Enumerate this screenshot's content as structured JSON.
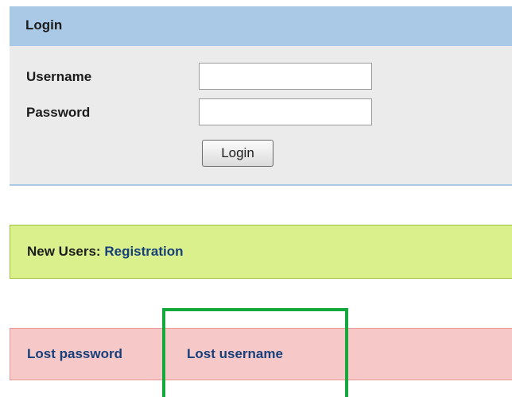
{
  "login": {
    "title": "Login",
    "username_label": "Username",
    "username_value": "",
    "password_label": "Password",
    "password_value": "",
    "submit_label": "Login"
  },
  "new_users": {
    "label": "New Users:",
    "link": "Registration"
  },
  "lost": {
    "password_link": "Lost password",
    "username_link": "Lost username"
  },
  "colors": {
    "login_header": "#a9c9e6",
    "login_body": "#ebebeb",
    "new_users_bg": "#d9f08d",
    "lost_bg": "#f7c8c8",
    "link": "#17407a",
    "highlight": "#15a83d"
  }
}
